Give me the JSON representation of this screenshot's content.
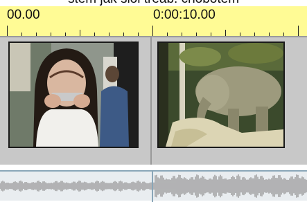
{
  "caption": "stem jak sloi treab. chobotem",
  "timeline": {
    "timecodes": [
      "00.00",
      "0:00:10.00"
    ]
  },
  "tracks": {
    "video": {
      "clips": [
        {
          "icon": "thumbnail-woman-harmonica"
        },
        {
          "icon": "thumbnail-elephant"
        }
      ]
    },
    "audio": {
      "icon": "waveform"
    }
  }
}
